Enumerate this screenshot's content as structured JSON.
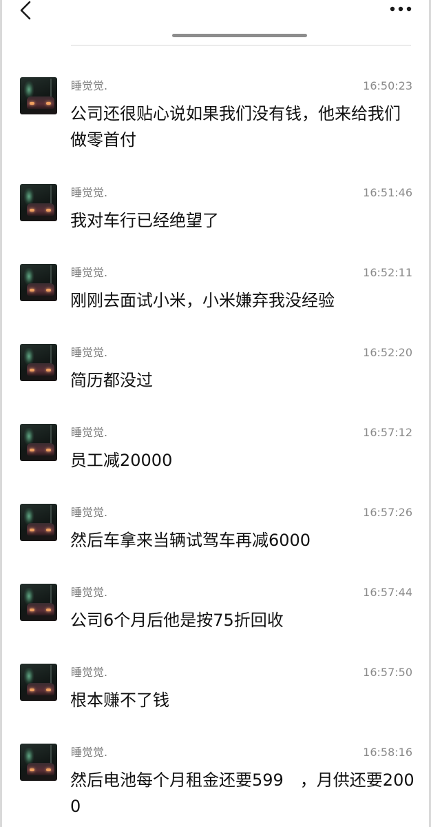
{
  "header": {
    "back_icon": "chevron-left-icon",
    "more_icon": "more-horizontal-icon"
  },
  "messages": [
    {
      "sender": "睡觉觉.",
      "time": "16:50:23",
      "text": "公司还很贴心说如果我们没有钱，他来给我们做零首付"
    },
    {
      "sender": "睡觉觉.",
      "time": "16:51:46",
      "text": "我对车行已经绝望了"
    },
    {
      "sender": "睡觉觉.",
      "time": "16:52:11",
      "text": "刚刚去面试小米，小米嫌弃我没经验"
    },
    {
      "sender": "睡觉觉.",
      "time": "16:52:20",
      "text": "简历都没过"
    },
    {
      "sender": "睡觉觉.",
      "time": "16:57:12",
      "text": "员工减20000"
    },
    {
      "sender": "睡觉觉.",
      "time": "16:57:26",
      "text": "然后车拿来当辆试驾车再减6000"
    },
    {
      "sender": "睡觉觉.",
      "time": "16:57:44",
      "text": "公司6个月后他是按75折回收"
    },
    {
      "sender": "睡觉觉.",
      "time": "16:57:50",
      "text": "根本赚不了钱"
    },
    {
      "sender": "睡觉觉.",
      "time": "16:58:16",
      "text": "然后电池每个月租金还要599　，月供还要2000"
    }
  ]
}
